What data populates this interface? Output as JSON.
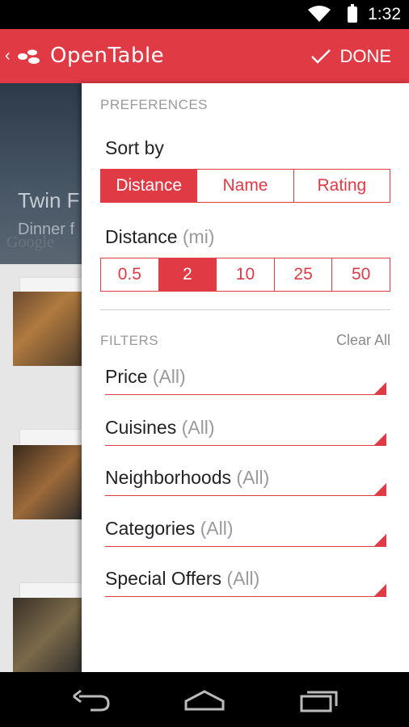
{
  "status_bar": {
    "time": "1:32"
  },
  "action_bar": {
    "brand": "OpenTable",
    "done_label": "DONE"
  },
  "background": {
    "hero_title": "Twin F",
    "hero_subtitle": "Dinner f",
    "map_watermark": "Google"
  },
  "drawer": {
    "preferences_header": "PREFERENCES",
    "sort_by_label": "Sort by",
    "sort_options": [
      {
        "label": "Distance",
        "selected": true
      },
      {
        "label": "Name",
        "selected": false
      },
      {
        "label": "Rating",
        "selected": false
      }
    ],
    "distance_label": "Distance",
    "distance_unit": "(mi)",
    "distance_options": [
      {
        "label": "0.5",
        "selected": false
      },
      {
        "label": "2",
        "selected": true
      },
      {
        "label": "10",
        "selected": false
      },
      {
        "label": "25",
        "selected": false
      },
      {
        "label": "50",
        "selected": false
      }
    ],
    "filters_header": "FILTERS",
    "clear_all_label": "Clear All",
    "filters": [
      {
        "name": "Price",
        "value": "(All)"
      },
      {
        "name": "Cuisines",
        "value": "(All)"
      },
      {
        "name": "Neighborhoods",
        "value": "(All)"
      },
      {
        "name": "Categories",
        "value": "(All)"
      },
      {
        "name": "Special Offers",
        "value": "(All)"
      }
    ]
  },
  "colors": {
    "accent": "#e03a45"
  }
}
